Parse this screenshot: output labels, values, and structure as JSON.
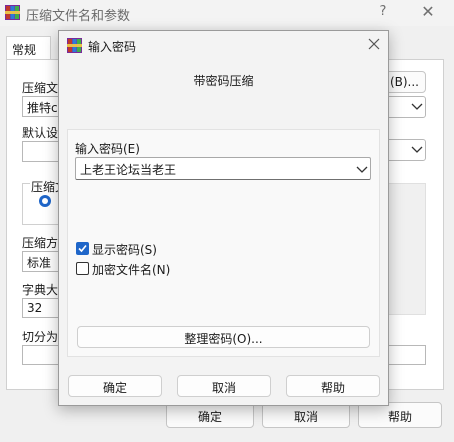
{
  "background_window": {
    "title": "压缩文件名和参数",
    "help_glyph": "?",
    "close_glyph": "✕",
    "tab_general": "常规",
    "archive_name_label": "压缩文",
    "archive_name_value": "推特co",
    "browse_button": "(B)...",
    "default_profile_label": "默认设",
    "format_label": "压缩文",
    "method_label": "压缩方",
    "method_value": "标准",
    "dict_size_label": "字典大",
    "dict_size_value": "32",
    "split_label": "切分为",
    "ok_button": "确定",
    "cancel_button": "取消",
    "help_button": "帮助"
  },
  "dialog": {
    "title": "输入密码",
    "close_glyph": "✕",
    "header_text": "带密码压缩",
    "password_label": "输入密码(E)",
    "password_value": "上老王论坛当老王",
    "show_password_label": "显示密码(S)",
    "show_password_checked": true,
    "encrypt_filenames_label": "加密文件名(N)",
    "encrypt_filenames_checked": false,
    "organize_button": "整理密码(O)...",
    "ok_button": "确定",
    "cancel_button": "取消",
    "help_button": "帮助"
  },
  "colors": {
    "accent": "#1f66c9",
    "window_bg": "#f0f0f0",
    "dialog_bg": "#f3f3f3"
  },
  "icons": [
    "winrar-icon",
    "close-icon",
    "help-icon",
    "chevron-down-icon",
    "checkmark-icon"
  ]
}
